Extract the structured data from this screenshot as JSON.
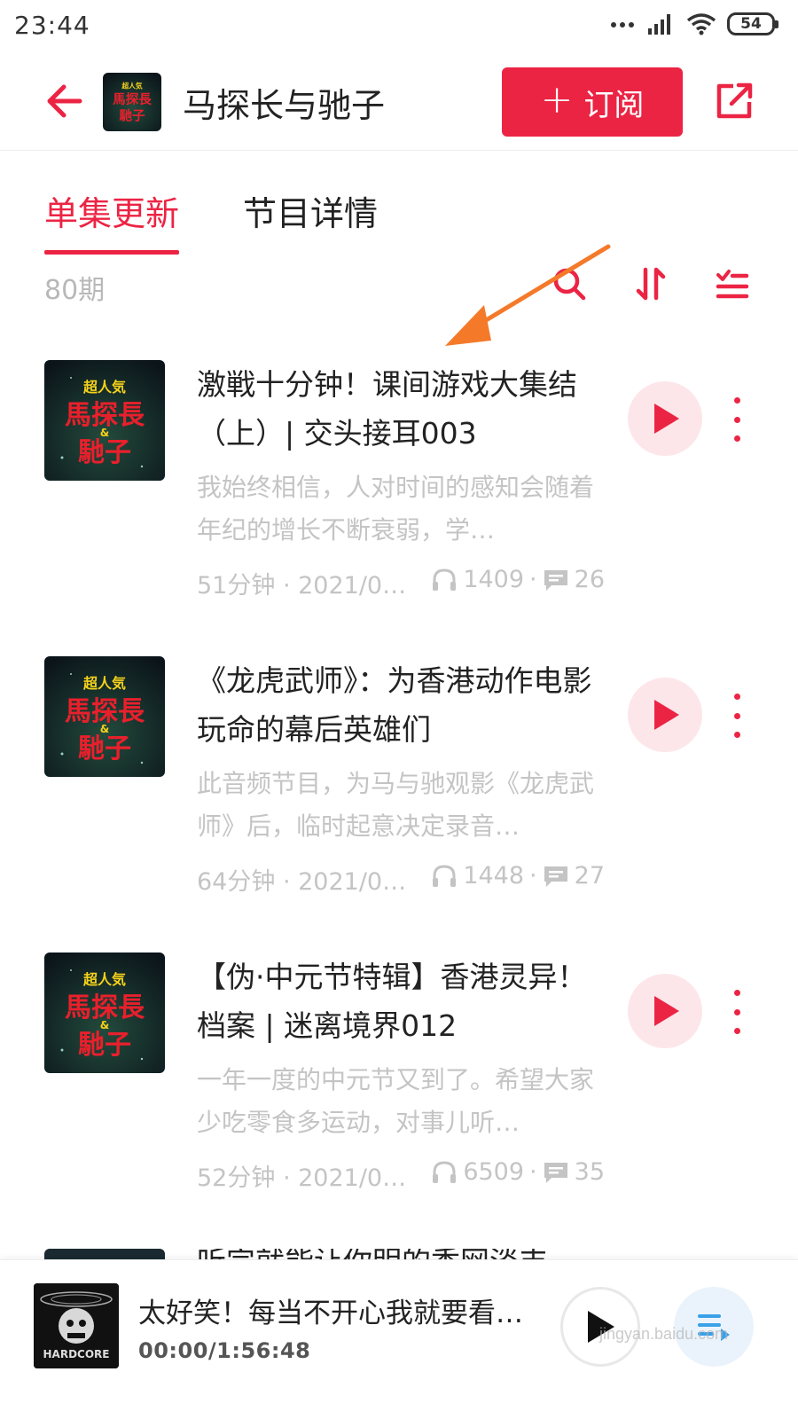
{
  "status_bar": {
    "time": "23:44",
    "battery": "54"
  },
  "header": {
    "title": "马探长与驰子",
    "subscribe_label": "订阅"
  },
  "tabs": [
    {
      "label": "单集更新",
      "active": true
    },
    {
      "label": "节目详情",
      "active": false
    }
  ],
  "toolbar": {
    "count": "80期"
  },
  "cover_art": {
    "line1": "超人気",
    "line2": "馬探長",
    "line3": "&",
    "line4": "馳子"
  },
  "episodes": [
    {
      "title": "激戦十分钟！课间游戏大集结（上）| 交头接耳003",
      "description": "我始终相信，人对时间的感知会随着年纪的增长不断衰弱，学…",
      "duration_date": "51分钟 · 2021/0…",
      "plays": "1409",
      "comments": "26"
    },
    {
      "title": "《龙虎武师》：为香港动作电影玩命的幕后英雄们",
      "description": "此音频节目，为马与驰观影《龙虎武师》后，临时起意决定录音…",
      "duration_date": "64分钟 · 2021/0…",
      "plays": "1448",
      "comments": "27"
    },
    {
      "title": "【伪·中元节特辑】香港灵异！档案 | 迷离境界012",
      "description": "一年一度的中元节又到了。希望大家少吃零食多运动，对事儿听…",
      "duration_date": "52分钟 · 2021/0…",
      "plays": "6509",
      "comments": "35"
    }
  ],
  "partial_episode": {
    "title": "听完就能让你明的香网淡丰"
  },
  "player": {
    "title": "太好笑！每当不开心我就要看…",
    "time": "00:00/1:56:48",
    "cover_text": "HARDCORE"
  },
  "watermark": "jingyan.baidu.com",
  "colors": {
    "accent": "#ec2444",
    "muted": "#c4c4c4",
    "arrow": "#f47a2a"
  }
}
